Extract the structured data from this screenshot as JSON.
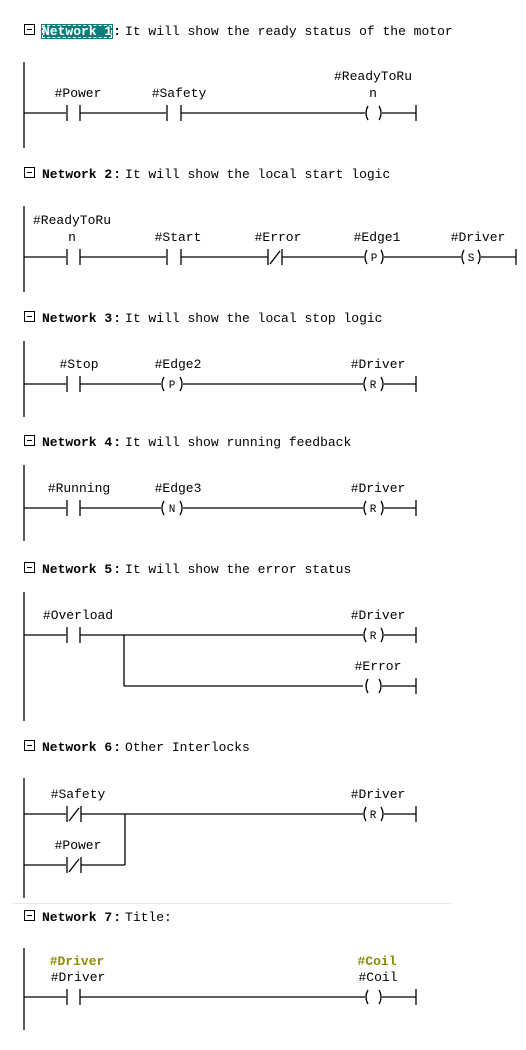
{
  "networks": [
    {
      "label": "Network 1",
      "colon": ":",
      "comment": "It will show the ready status of the motor",
      "selected": true,
      "elements": [
        {
          "type": "contact_no",
          "operand": "#Power"
        },
        {
          "type": "contact_no",
          "operand": "#Safety"
        },
        {
          "type": "coil",
          "operand_line1": "#ReadyToRu",
          "operand_line2": "n",
          "letter": ""
        }
      ]
    },
    {
      "label": "Network 2",
      "colon": ":",
      "comment": "It will show the local start logic",
      "elements": [
        {
          "type": "contact_no",
          "operand_line1": "#ReadyToRu",
          "operand_line2": "n"
        },
        {
          "type": "contact_no",
          "operand": "#Start"
        },
        {
          "type": "contact_nc",
          "operand": "#Error"
        },
        {
          "type": "coil",
          "operand": "#Edge1",
          "letter": "P"
        },
        {
          "type": "coil",
          "operand": "#Driver",
          "letter": "S"
        }
      ]
    },
    {
      "label": "Network 3",
      "colon": ":",
      "comment": "It will show the local stop logic",
      "elements": [
        {
          "type": "contact_no",
          "operand": "#Stop"
        },
        {
          "type": "coil",
          "operand": "#Edge2",
          "letter": "P"
        },
        {
          "type": "coil",
          "operand": "#Driver",
          "letter": "R"
        }
      ]
    },
    {
      "label": "Network 4",
      "colon": ":",
      "comment": "It will show running feedback",
      "elements": [
        {
          "type": "contact_no",
          "operand": "#Running"
        },
        {
          "type": "coil",
          "operand": "#Edge3",
          "letter": "N"
        },
        {
          "type": "coil",
          "operand": "#Driver",
          "letter": "R"
        }
      ]
    },
    {
      "label": "Network 5",
      "colon": ":",
      "comment": "It will show the error status",
      "elements": [
        {
          "type": "contact_no",
          "operand": "#Overload"
        },
        {
          "type": "coil",
          "operand": "#Driver",
          "letter": "R"
        },
        {
          "type": "coil",
          "operand": "#Error",
          "letter": ""
        }
      ]
    },
    {
      "label": "Network 6",
      "colon": ":",
      "comment": "Other Interlocks",
      "elements": [
        {
          "type": "contact_nc",
          "operand": "#Safety"
        },
        {
          "type": "contact_nc",
          "operand": "#Power"
        },
        {
          "type": "coil",
          "operand": "#Driver",
          "letter": "R"
        }
      ]
    },
    {
      "label": "Network 7",
      "colon": ":",
      "comment": "Title:",
      "elements": [
        {
          "type": "contact_no",
          "symbol": "#Driver",
          "operand": "#Driver"
        },
        {
          "type": "coil",
          "symbol": "#Coil",
          "operand": "#Coil",
          "letter": ""
        }
      ]
    }
  ],
  "colors": {
    "selection": "#0b7c78",
    "symbol_text": "#8c8c00"
  }
}
